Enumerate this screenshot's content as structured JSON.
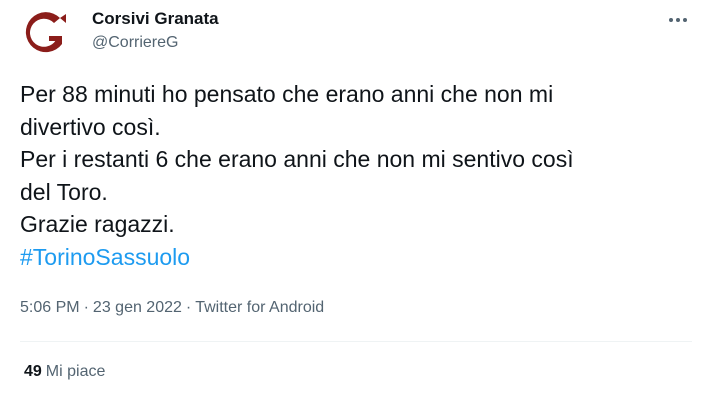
{
  "author": {
    "display_name": "Corsivi Granata",
    "handle": "@CorriereG",
    "avatar_letter": "G",
    "avatar_color": "#8b1d1a"
  },
  "tweet": {
    "lines": [
      "Per 88 minuti ho pensato che erano anni che non mi",
      "divertivo così.",
      "Per i restanti 6 che erano anni che non mi sentivo così",
      "del Toro.",
      "Grazie ragazzi."
    ],
    "hashtag": "#TorinoSassuolo"
  },
  "meta": {
    "time": "5:06 PM",
    "separator": "·",
    "date": "23 gen 2022",
    "source": "Twitter for Android"
  },
  "engagement": {
    "likes_count": "49",
    "likes_label": "Mi piace"
  },
  "icons": {
    "more": "more-icon"
  },
  "colors": {
    "link": "#1d9bf0",
    "secondary_text": "#536471",
    "primary_text": "#0f1419"
  }
}
